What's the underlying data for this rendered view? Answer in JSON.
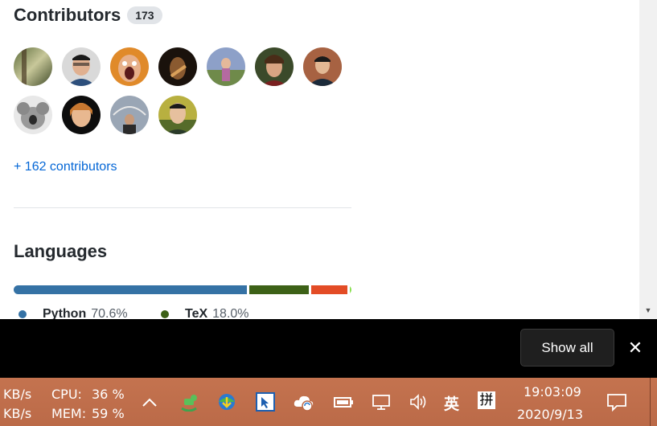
{
  "contributors": {
    "title": "Contributors",
    "count": "173",
    "more_link": "+ 162 contributors"
  },
  "languages": {
    "title": "Languages",
    "items": [
      {
        "name": "Python",
        "percent": "70.6%",
        "color": "#3572A5",
        "share": 70.6
      },
      {
        "name": "TeX",
        "percent": "18.0%",
        "color": "#3D6117",
        "share": 18.0
      }
    ],
    "other_segments": [
      {
        "color": "#e34c26",
        "share": 10.9
      },
      {
        "color": "#89e051",
        "share": 0.5
      }
    ]
  },
  "banner": {
    "show_all_label": "Show all",
    "close_icon": "close-icon"
  },
  "taskbar": {
    "net_up": "KB/s",
    "net_down": "KB/s",
    "cpu_label": "CPU:",
    "cpu_value": "36 %",
    "mem_label": "MEM:",
    "mem_value": "59 %",
    "ime_lang": "英",
    "ime_mode": "拼",
    "time": "19:03:09",
    "date": "2020/9/13"
  }
}
